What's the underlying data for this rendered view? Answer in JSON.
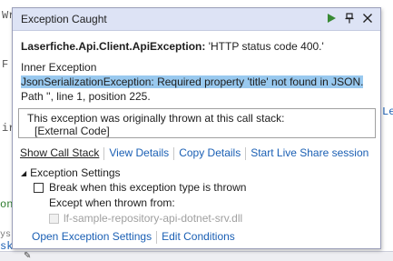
{
  "editor": {
    "fragments": [
      "Wr",
      "F",
      "ir",
      "Lef",
      "on",
      "ys",
      "sk"
    ]
  },
  "popup": {
    "title": "Exception Caught",
    "exception_type": "Laserfiche.Api.Client.ApiException:",
    "exception_message": " 'HTTP status code 400.'",
    "inner_exception_label": "Inner Exception",
    "inner_exception_message": "JsonSerializationException: Required property 'title' not found in JSON.",
    "inner_exception_path": "Path '', line 1, position 225.",
    "call_stack_header": "This exception was originally thrown at this call stack:",
    "call_stack_entry": "[External Code]",
    "links": {
      "show_call_stack": "Show Call Stack",
      "view_details": "View Details",
      "copy_details": "Copy Details",
      "start_live_share": "Start Live Share session"
    },
    "settings": {
      "header": "Exception Settings",
      "break_when_thrown": "Break when this exception type is thrown",
      "except_when_thrown_from": "Except when thrown from:",
      "module_name": "lf-sample-repository-api-dotnet-srv.dll"
    },
    "bottom_links": {
      "open_settings": "Open Exception Settings",
      "edit_conditions": "Edit Conditions"
    }
  },
  "colors": {
    "header_bg": "#dde3f5",
    "link": "#1a5fb4",
    "selection": "#99c9ef",
    "continue_green": "#388a34"
  }
}
